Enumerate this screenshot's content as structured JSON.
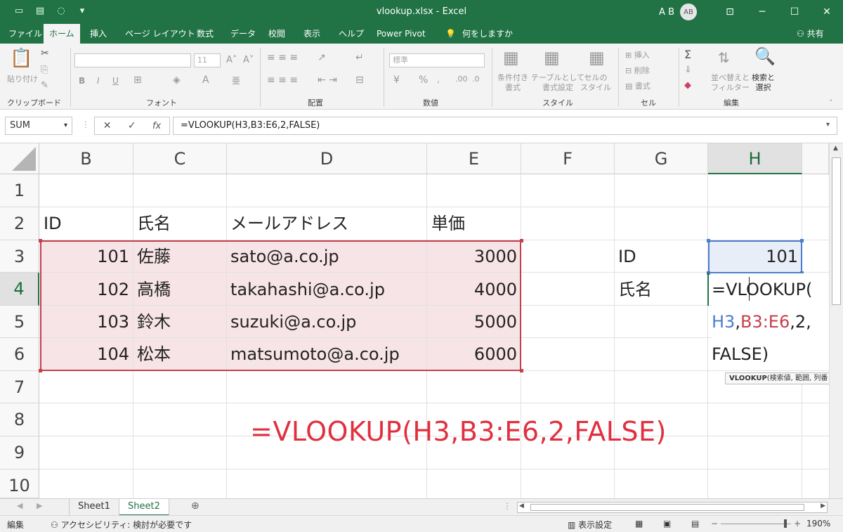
{
  "titlebar": {
    "title": "vlookup.xlsx  -  Excel",
    "user": "A B",
    "avatar": "AB",
    "qat_icons": [
      "autosave-icon",
      "save-icon",
      "touch-mode-icon",
      "customize-qat-icon"
    ],
    "window_buttons": [
      "ribbon-display-icon",
      "minimize-icon",
      "maximize-icon",
      "close-icon"
    ]
  },
  "menu": {
    "tabs": [
      "ファイル",
      "ホーム",
      "挿入",
      "ページ レイアウト",
      "数式",
      "データ",
      "校閲",
      "表示",
      "ヘルプ",
      "Power Pivot",
      "何をしますか"
    ],
    "active": "ホーム",
    "share": "共有"
  },
  "ribbon": {
    "groups": [
      "クリップボード",
      "フォント",
      "配置",
      "数値",
      "スタイル",
      "セル",
      "編集"
    ],
    "paste": "貼り付け",
    "font_size": "11",
    "number_format": "標準",
    "conditional": "条件付き\n書式",
    "as_table": "テーブルとして\n書式設定",
    "cell_style": "セルの\nスタイル",
    "insert": "挿入",
    "delete": "削除",
    "format": "書式",
    "sort_filter": "並べ替えと\nフィルター",
    "find_select": "検索と\n選択"
  },
  "formula_bar": {
    "name_box": "SUM",
    "formula": "=VLOOKUP(H3,B3:E6,2,FALSE)"
  },
  "grid": {
    "columns": [
      "B",
      "C",
      "D",
      "E",
      "F",
      "G",
      "H"
    ],
    "rows": [
      "1",
      "2",
      "3",
      "4",
      "5",
      "6",
      "7",
      "8",
      "9",
      "10"
    ],
    "headers": {
      "id": "ID",
      "name": "氏名",
      "email": "メールアドレス",
      "price": "単価"
    },
    "data": [
      {
        "id": "101",
        "name": "佐藤",
        "email": "sato@a.co.jp",
        "price": "3000"
      },
      {
        "id": "102",
        "name": "高橋",
        "email": "takahashi@a.co.jp",
        "price": "4000"
      },
      {
        "id": "103",
        "name": "鈴木",
        "email": "suzuki@a.co.jp",
        "price": "5000"
      },
      {
        "id": "104",
        "name": "松本",
        "email": "matsumoto@a.co.jp",
        "price": "6000"
      }
    ],
    "lookup_label": "ID",
    "lookup_value": "101",
    "result_label": "氏名",
    "edit_line1": "=VLOOKUP(",
    "edit_line2_a": "H3",
    "edit_line2_b": ",",
    "edit_line2_c": "B3:E6",
    "edit_line2_d": ",2,",
    "edit_line3": "FALSE)",
    "tooltip_fn": "VLOOKUP",
    "tooltip_args": "(検索値, 範囲, 列番",
    "annotation": "=VLOOKUP(H3,B3:E6,2,FALSE)"
  },
  "sheets": {
    "tabs": [
      "Sheet1",
      "Sheet2"
    ],
    "active": "Sheet2"
  },
  "status": {
    "mode": "編集",
    "accessibility": "アクセシビリティ: 検討が必要です",
    "display_settings": "表示設定",
    "zoom": "190%"
  },
  "colors": {
    "accent": "#217346",
    "range_ref": "#c5404e",
    "cell_ref": "#4c7ecb",
    "annotation": "#e03040"
  }
}
